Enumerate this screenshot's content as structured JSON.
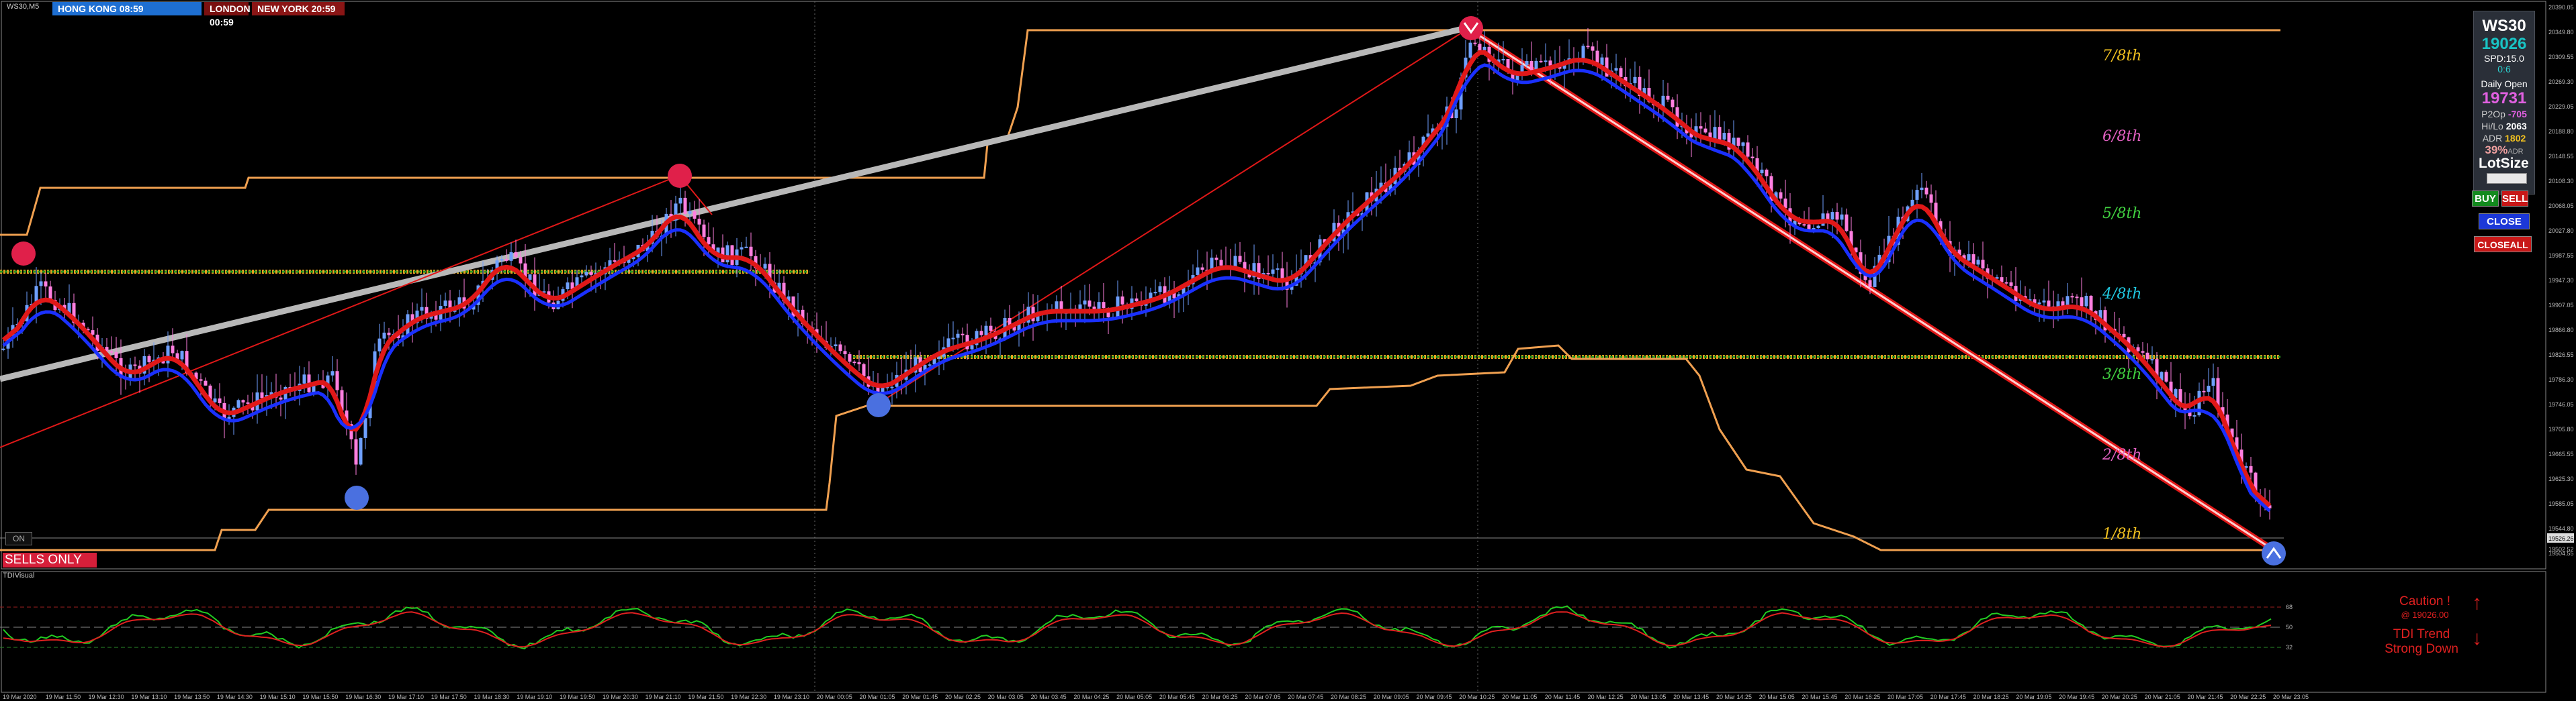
{
  "symbol_label": "WS30,M5",
  "sessions": [
    {
      "label": "HONG KONG 08:59",
      "color": "#1e6fd2"
    },
    {
      "label": "LONDON  00:59",
      "color": "#7a1010"
    },
    {
      "label": "NEW YORK  20:59",
      "color": "#8a1515"
    }
  ],
  "levels": [
    {
      "label": "7/8th",
      "color": "#f0c020"
    },
    {
      "label": "6/8th",
      "color": "#e060c0"
    },
    {
      "label": "5/8th",
      "color": "#40d040"
    },
    {
      "label": "4/8th",
      "color": "#20c8e0"
    },
    {
      "label": "3/8th",
      "color": "#40d040"
    },
    {
      "label": "2/8th",
      "color": "#e060c0"
    },
    {
      "label": "1/8th",
      "color": "#f0c020"
    }
  ],
  "price_axis": [
    "20390.05",
    "20349.80",
    "20309.55",
    "20269.30",
    "20229.05",
    "20188.80",
    "20148.55",
    "20108.30",
    "20068.05",
    "20027.80",
    "19987.55",
    "19947.30",
    "19907.05",
    "19866.80",
    "19826.55",
    "19786.30",
    "19746.05",
    "19705.80",
    "19665.55",
    "19625.30",
    "19585.05",
    "19544.80",
    "19504.55"
  ],
  "price_tags": {
    "current": "19526.26",
    "next": "19502.52"
  },
  "time_axis": [
    "19 Mar 2020",
    "19 Mar 11:50",
    "19 Mar 12:30",
    "19 Mar 13:10",
    "19 Mar 13:50",
    "19 Mar 14:30",
    "19 Mar 15:10",
    "19 Mar 15:50",
    "19 Mar 16:30",
    "19 Mar 17:10",
    "19 Mar 17:50",
    "19 Mar 18:30",
    "19 Mar 19:10",
    "19 Mar 19:50",
    "19 Mar 20:30",
    "19 Mar 21:10",
    "19 Mar 21:50",
    "19 Mar 22:30",
    "19 Mar 23:10",
    "20 Mar 00:05",
    "20 Mar 01:05",
    "20 Mar 01:45",
    "20 Mar 02:25",
    "20 Mar 03:05",
    "20 Mar 03:45",
    "20 Mar 04:25",
    "20 Mar 05:05",
    "20 Mar 05:45",
    "20 Mar 06:25",
    "20 Mar 07:05",
    "20 Mar 07:45",
    "20 Mar 08:25",
    "20 Mar 09:05",
    "20 Mar 09:45",
    "20 Mar 10:25",
    "20 Mar 11:05",
    "20 Mar 11:45",
    "20 Mar 12:25",
    "20 Mar 13:05",
    "20 Mar 13:45",
    "20 Mar 14:25",
    "20 Mar 15:05",
    "20 Mar 15:45",
    "20 Mar 16:25",
    "20 Mar 17:05",
    "20 Mar 17:45",
    "20 Mar 18:25",
    "20 Mar 19:05",
    "20 Mar 19:45",
    "20 Mar 20:25",
    "20 Mar 21:05",
    "20 Mar 21:45",
    "20 Mar 22:25",
    "20 Mar 23:05"
  ],
  "on_label": "ON",
  "sells_only": "SELLS ONLY",
  "tdi_label": "TDIVisual",
  "tdi_axis": [
    "68",
    "50",
    "32"
  ],
  "panel": {
    "symbol": "WS30",
    "price": "19026",
    "spread": "SPD:15.0",
    "zero": "0:6",
    "daily_open_label": "Daily Open",
    "daily_open": "19731",
    "p2op_label": "P2Op",
    "p2op": "-705",
    "hilo_label": "Hi/Lo",
    "hilo": "2063",
    "adr_label": "ADR",
    "adr": "1802",
    "pct": "39%",
    "adr_suffix": "ADR"
  },
  "lotsize_label": "LotSize",
  "buttons": {
    "buy": "BUY",
    "sell": "SELL",
    "close": "CLOSE",
    "closeall": "CLOSEALL"
  },
  "caution_line1": "Caution !",
  "caution_line2": "@ 19026.00",
  "tdi_trend_line1": "TDI Trend",
  "tdi_trend_line2": "Strong Down",
  "colors": {
    "bull": "#6fa0ff",
    "bear": "#ff7fe0",
    "fast_ma": "#e01818",
    "slow_ma": "#1a30ff",
    "band": "#f0a050",
    "level": "#e8a020"
  }
}
